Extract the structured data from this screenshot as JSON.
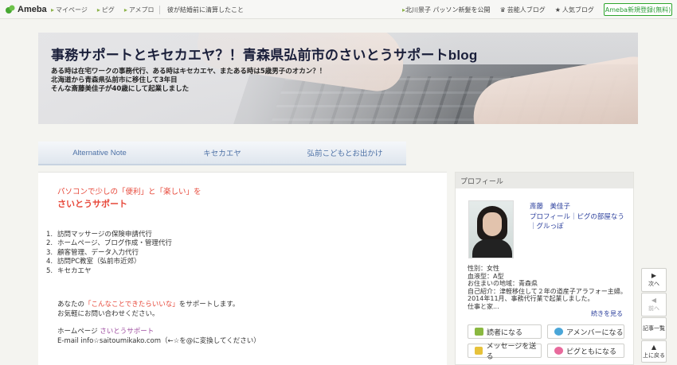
{
  "topbar": {
    "logo_text": "Ameba",
    "nav": [
      "マイページ",
      "ピグ",
      "アメプロ"
    ],
    "news": "彼が結婚前に清算したこと",
    "topic": "北川景子 パッソン新髪を公開",
    "celeb_blog": "芸能人ブログ",
    "popular_blog": "人気ブログ",
    "register_label": "Ameba新規登録(無料)",
    "accent": "#2a9c36"
  },
  "header": {
    "title": "事務サポートとキセカエヤ？！青森県弘前市のさいとうサポートblog",
    "desc": [
      "ある時は在宅ワークの事務代行、ある時はキセカエヤ、またある時は5歳男子のオカン？！",
      "北海道から青森県弘前市に移住して3年目",
      "そんな斎藤美佳子が40歳にして起業しました"
    ]
  },
  "nav_tabs": [
    "Alternative Note",
    "キセカエヤ",
    "弘前こどもとお出かけ"
  ],
  "main": {
    "lead1": "パソコンで少しの「便利」と「楽しい」を",
    "lead2": "さいとうサポート",
    "services": [
      {
        "num": "1.",
        "label": "訪問マッサージの保険申請代行"
      },
      {
        "num": "2.",
        "label": "ホームページ、ブログ作成・管理代行"
      },
      {
        "num": "3.",
        "label": "顧客管理、データ入力代行"
      },
      {
        "num": "4.",
        "label": "訪問PC教室（弘前市近郊）"
      },
      {
        "num": "5.",
        "label": "キセカエヤ"
      }
    ],
    "note_prefix": "あなたの",
    "note_highlight": "「こんなことできたらいいな」",
    "note_suffix": "をサポートします。",
    "note2": "お気軽にお問い合わせください。",
    "hp_label": "ホームページ",
    "hp_link": "さいとうサポート",
    "mail": "E-mail info☆saitoumikako.com（←☆を@に変換してください）",
    "highlight_color": "#e7483a"
  },
  "profile": {
    "header": "プロフィール",
    "name": "斎藤　美佳子",
    "links": "プロフィール｜ピグの部屋なう｜グルっぽ",
    "info": [
      "性別：女性",
      "血液型：A型",
      "お住まいの地域：青森県",
      "自己紹介：津軽移住して２年の道産子アラフォー主婦。 2014年11月、事務代行業で起業しました。",
      "仕事と家..."
    ],
    "more": "続きを見る",
    "buttons": {
      "reader": "読者になる",
      "amember": "アメンバーになる",
      "message": "メッセージを送る",
      "pigfriend": "ピグともになる"
    }
  },
  "sidenav": {
    "next": "次へ",
    "prev": "前へ",
    "list": "記事一覧",
    "top": "上に戻る"
  }
}
